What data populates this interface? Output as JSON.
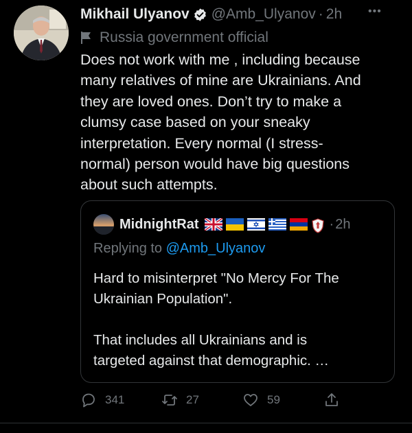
{
  "tweet": {
    "author": {
      "name": "Mikhail Ulyanov",
      "handle": "@Amb_Ulyanov",
      "dot": "·",
      "time": "2h",
      "label": "Russia government official"
    },
    "more_label": "•••",
    "text": "Does not work with me , including because\nmany relatives of mine are Ukrainians. And\nthey are loved ones. Don’t try to make a\nclumsy case based on your sneaky\ninterpretation. Every normal (I stress-\nnormal) person would have big questions\nabout such attempts.",
    "quote": {
      "author_name": "MidnightRat",
      "flag_icons": [
        "uk-flag-icon",
        "ukraine-flag-icon",
        "israel-flag-icon",
        "greece-flag-icon",
        "armenia-flag-icon",
        "shield-emblem-icon"
      ],
      "dot": "·",
      "time": "2h",
      "replying_prefix": "Replying to ",
      "replying_mention": "@Amb_Ulyanov",
      "text": "Hard to misinterpret \"No Mercy For The\nUkrainian Population\".\n\nThat includes all Ukrainians and is\ntargeted against that demographic. …"
    },
    "actions": {
      "reply_count": "341",
      "retweet_count": "27",
      "like_count": "59"
    }
  },
  "colors": {
    "background": "#000000",
    "text": "#e7e9ea",
    "muted": "#71767b",
    "link": "#1d9bf0",
    "border": "#333639"
  }
}
